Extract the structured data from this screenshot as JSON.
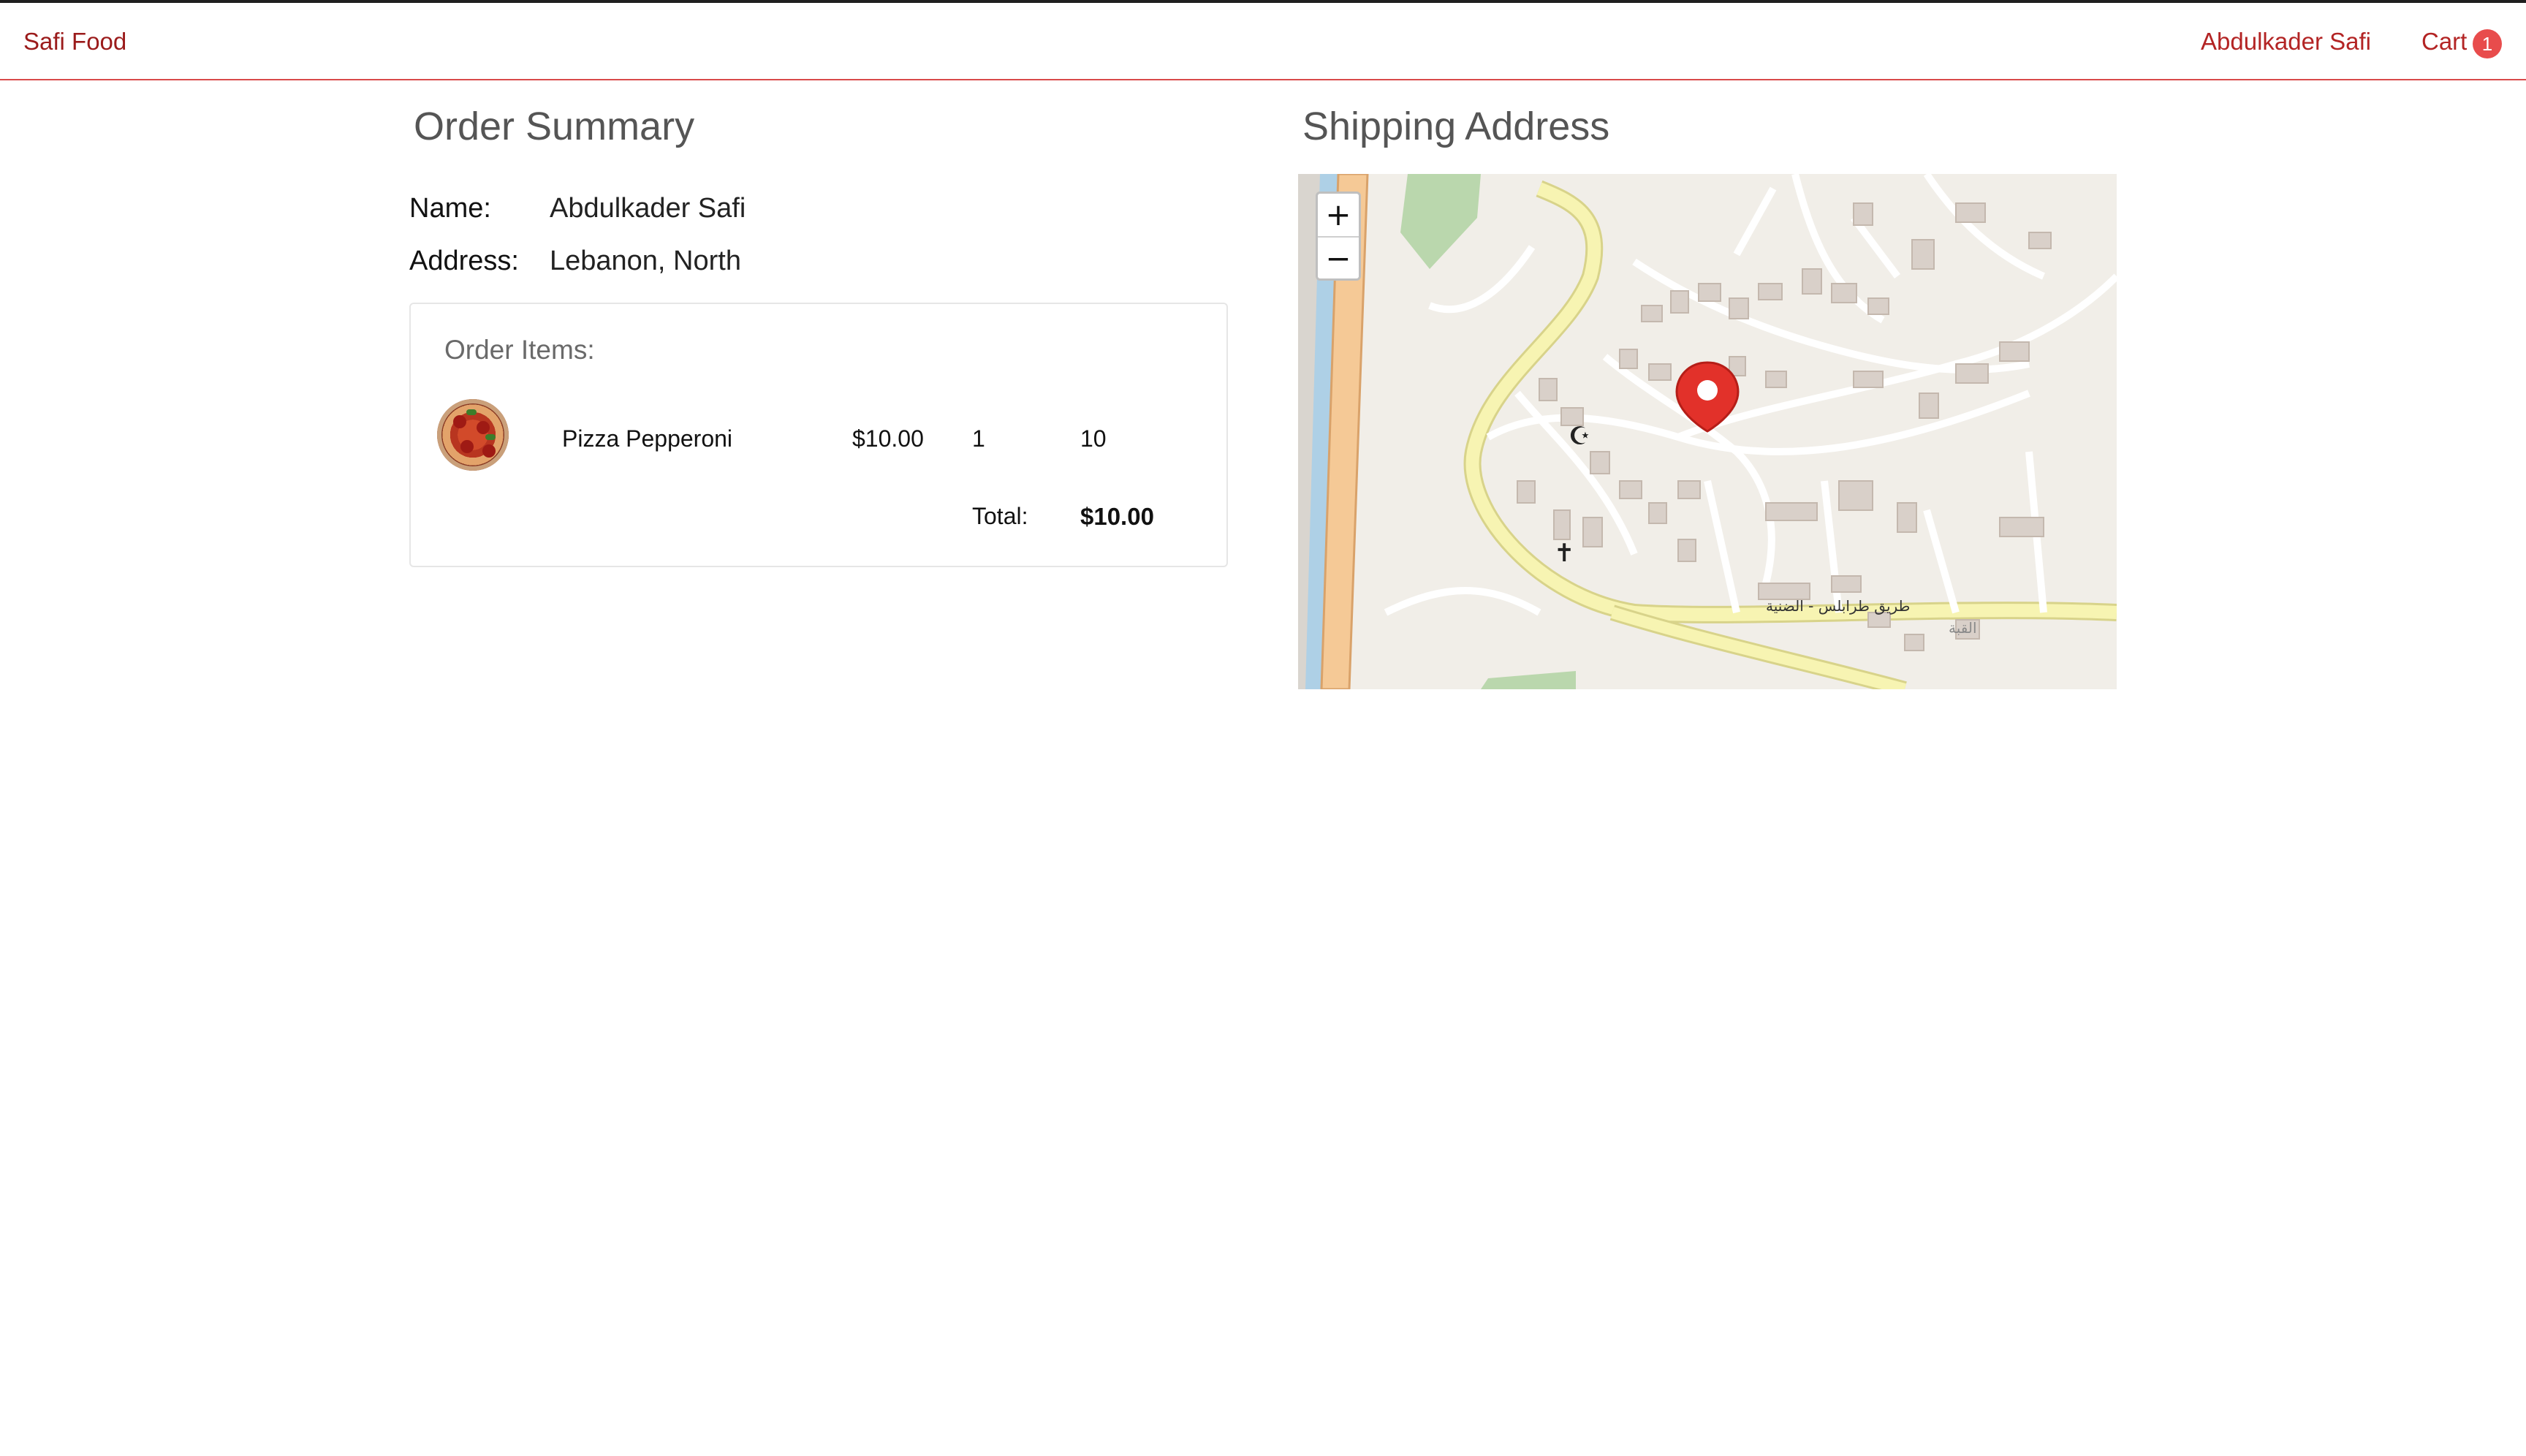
{
  "navbar": {
    "brand": "Safi Food",
    "user": "Abdulkader Safi",
    "cart_label": "Cart",
    "cart_count": "1",
    "accent": "#b32424",
    "badge_color": "#e84c4c"
  },
  "order_summary": {
    "title": "Order Summary",
    "name_label": "Name:",
    "name_value": "Abdulkader Safi",
    "address_label": "Address:",
    "address_value": "Lebanon, North",
    "items_title": "Order Items:",
    "items": [
      {
        "image_icon": "pizza-pepperoni-photo",
        "name": "Pizza Pepperoni",
        "price": "$10.00",
        "quantity": "1",
        "subtotal": "10"
      }
    ],
    "total_label": "Total:",
    "total_value": "$10.00"
  },
  "shipping": {
    "title": "Shipping Address",
    "zoom_in": "+",
    "zoom_out": "−",
    "marker_icon": "map-pin-icon",
    "marker_color": "#e2312a",
    "road_label": "طريق طرابلس - الضنية",
    "place_label": "القبة"
  }
}
